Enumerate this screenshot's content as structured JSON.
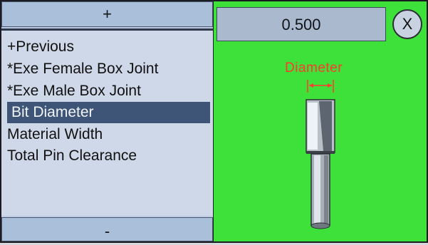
{
  "list_panel": {
    "scroll_up_label": "+",
    "scroll_down_label": "-",
    "items": [
      {
        "label": "+Previous"
      },
      {
        "label": "*Exe Female Box Joint"
      },
      {
        "label": "*Exe Male Box Joint"
      },
      {
        "label": "Bit Diameter",
        "selected": true
      },
      {
        "label": "Material Width"
      },
      {
        "label": "Total Pin Clearance"
      }
    ]
  },
  "detail_panel": {
    "value": "0.500",
    "close_label": "X",
    "diagram_label": "Diameter",
    "background_color": "#3ee03a",
    "label_color": "#ff3b2f",
    "icon": "router-bit-icon"
  }
}
